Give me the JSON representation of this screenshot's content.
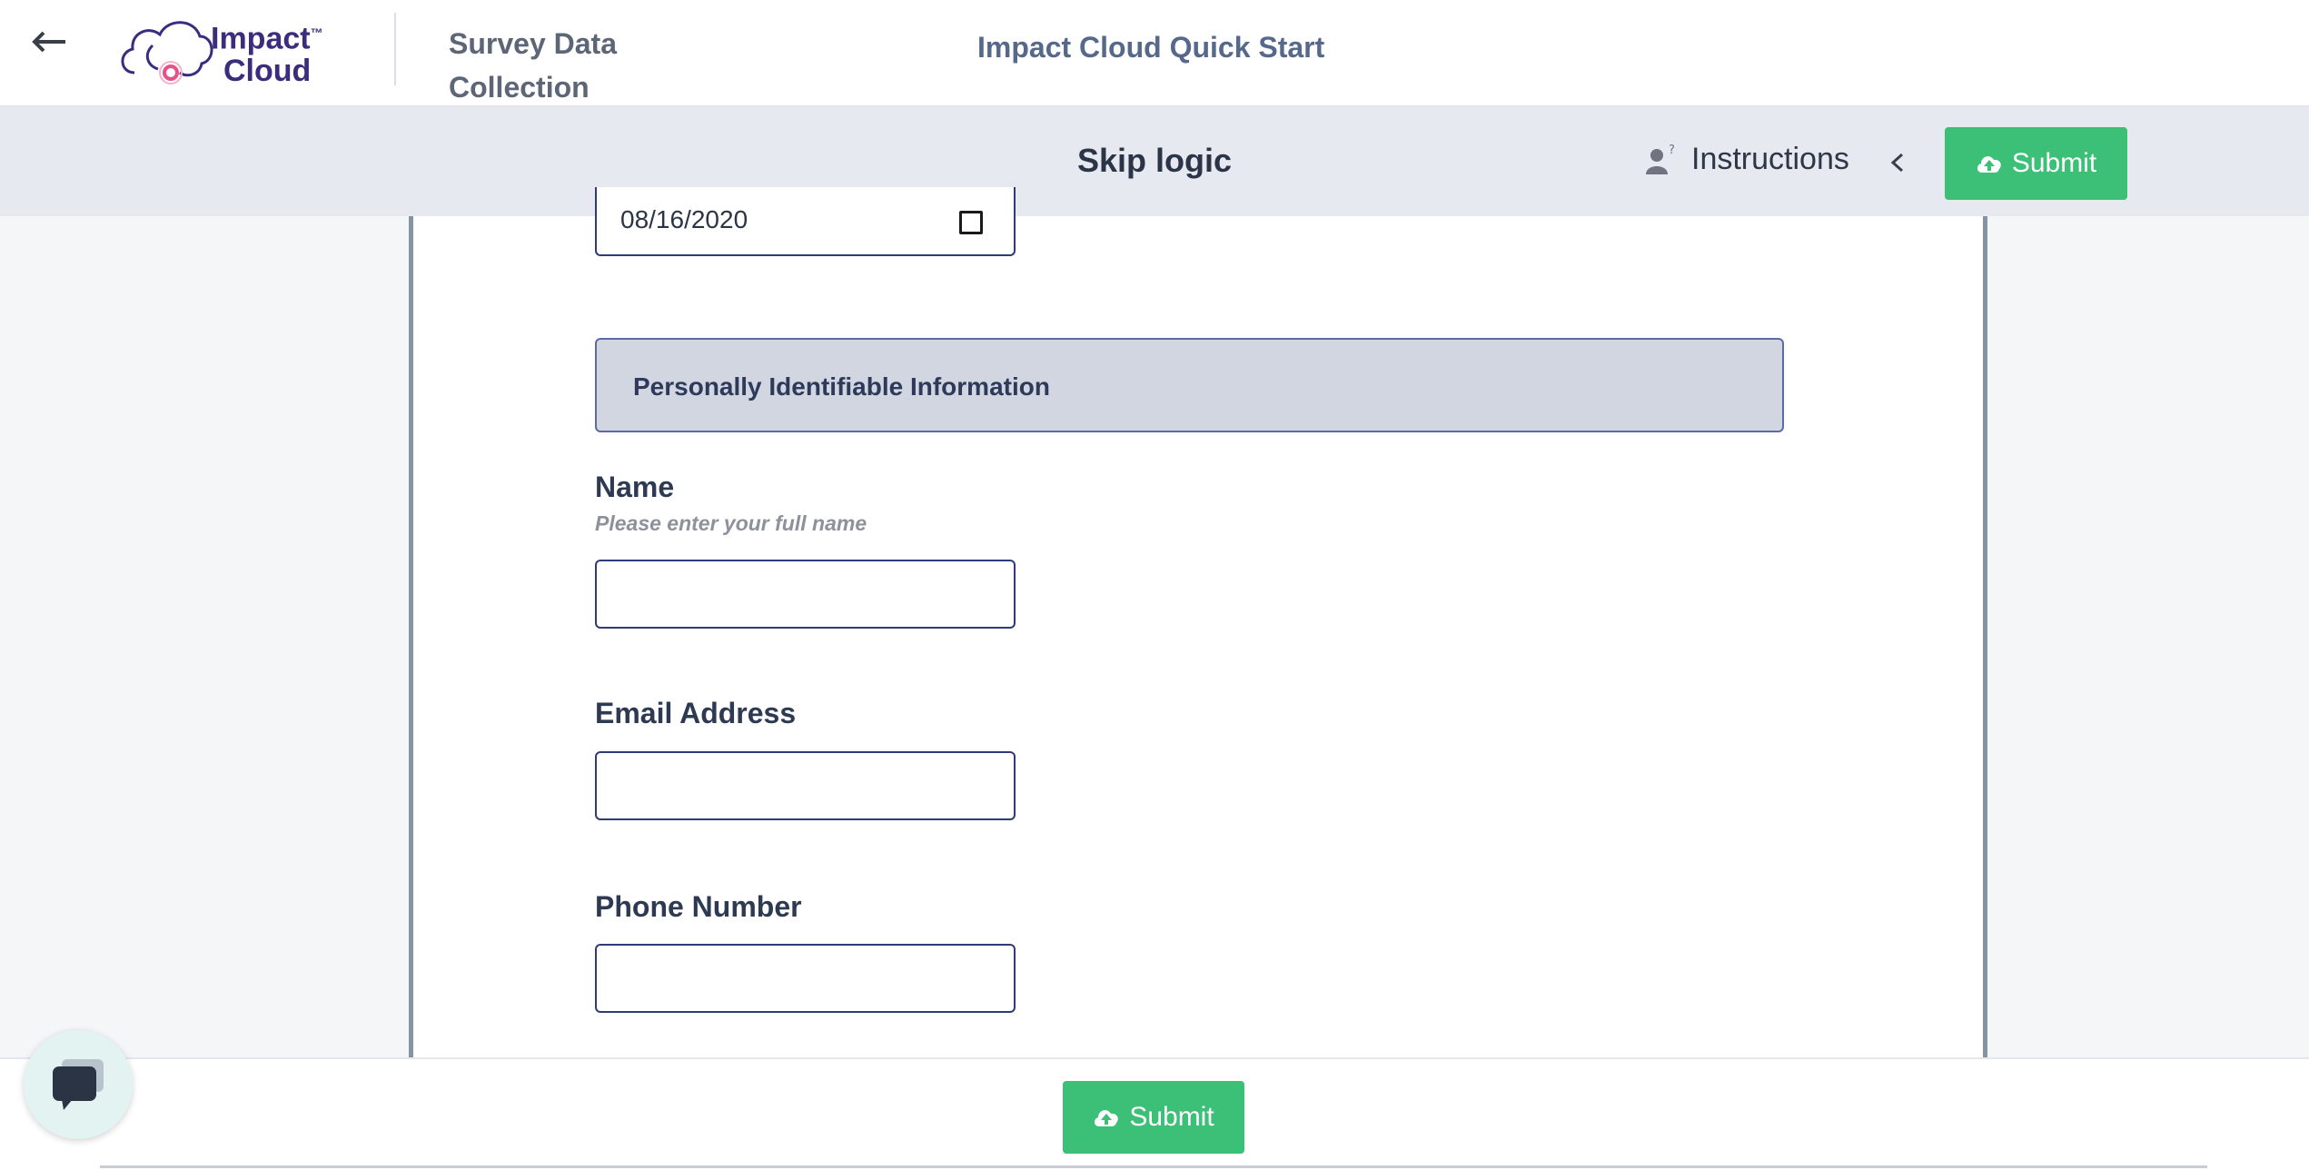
{
  "header": {
    "logo_line1": "Impact",
    "logo_tm": "™",
    "logo_line2": "Cloud",
    "survey_name": "Survey Data Collection",
    "project_name": "Impact Cloud Quick Start"
  },
  "subbar": {
    "page_title": "Skip logic",
    "instructions_label": "Instructions",
    "submit_label": "Submit"
  },
  "form": {
    "date_value": "08/16/2020",
    "section_title": "Personally Identifiable Information",
    "fields": [
      {
        "label": "Name",
        "hint": "Please enter your full name",
        "value": ""
      },
      {
        "label": "Email Address",
        "value": ""
      },
      {
        "label": "Phone Number",
        "value": ""
      }
    ]
  },
  "footer": {
    "submit_label": "Submit"
  },
  "colors": {
    "accent_green": "#3cbf76",
    "brand_purple": "#3b2c7e",
    "logo_pink": "#e8508a",
    "input_border": "#2e3a7a"
  },
  "icons": [
    "back-arrow-icon",
    "instructions-person-icon",
    "chevron-left-icon",
    "cloud-upload-icon",
    "calendar-icon",
    "chat-icon"
  ]
}
